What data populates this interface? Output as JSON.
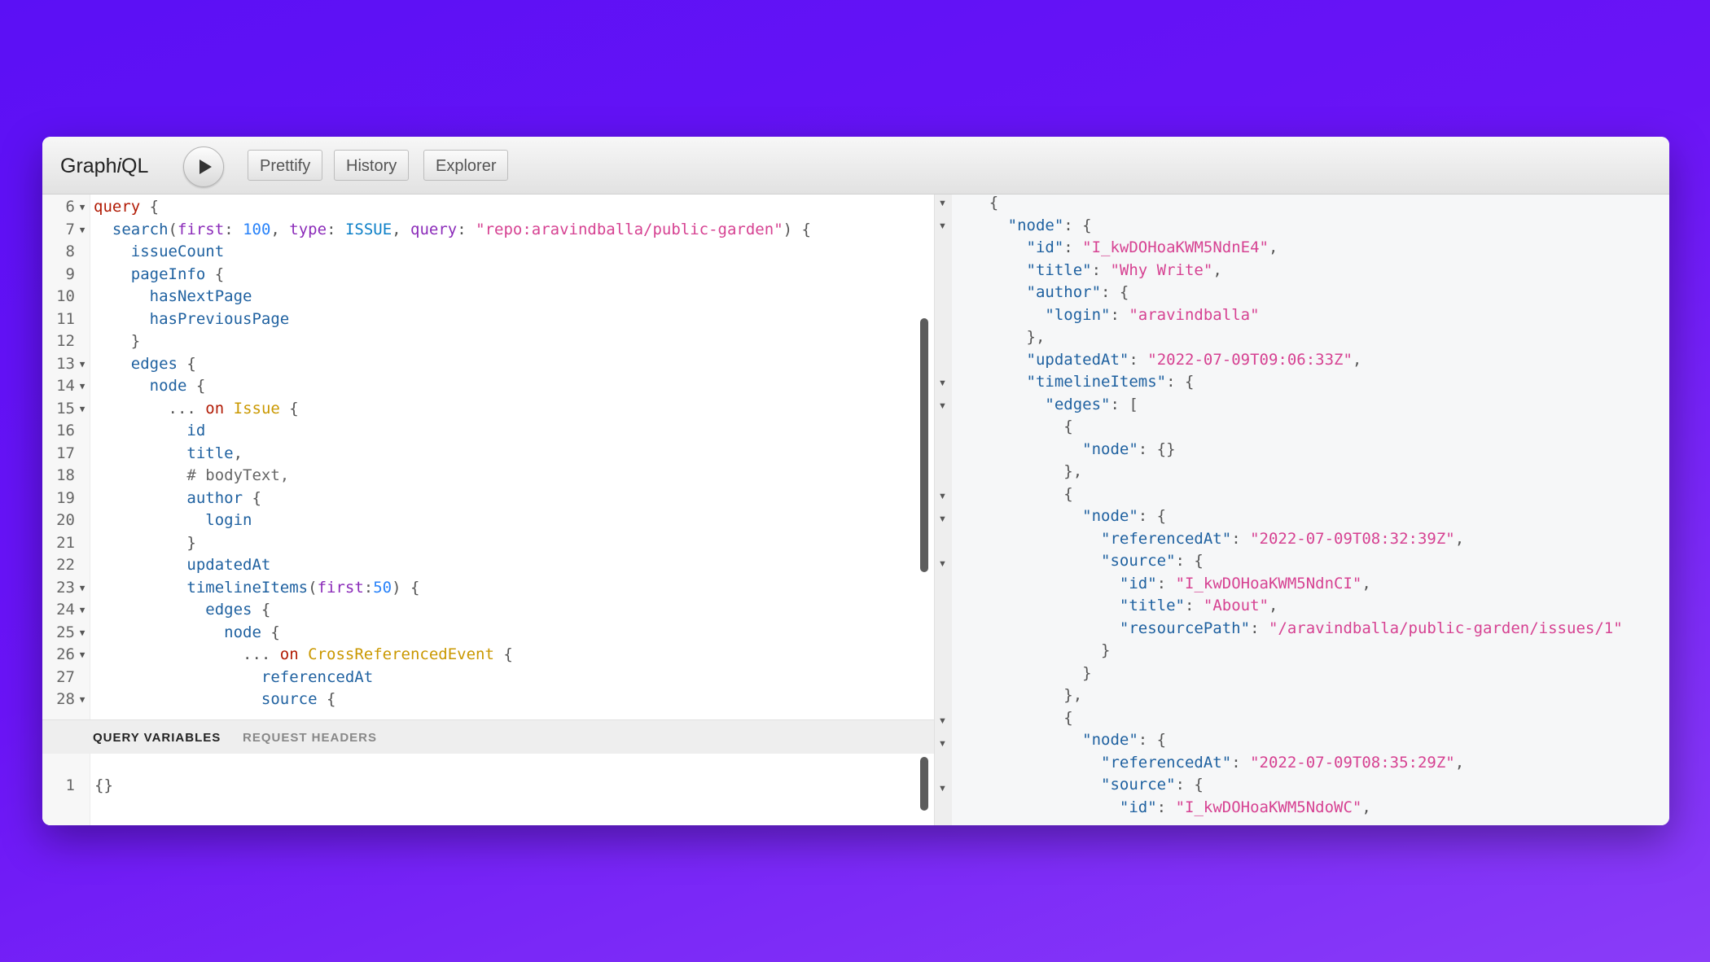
{
  "toolbar": {
    "logo_prefix": "Graph",
    "logo_i": "i",
    "logo_suffix": "QL",
    "prettify": "Prettify",
    "history": "History",
    "explorer": "Explorer"
  },
  "editor": {
    "lines": [
      {
        "n": "6",
        "fold": true,
        "tokens": [
          [
            "kw",
            "query"
          ],
          [
            "pn",
            " {"
          ]
        ]
      },
      {
        "n": "7",
        "fold": true,
        "tokens": [
          [
            "pn",
            "  "
          ],
          [
            "fn",
            "search"
          ],
          [
            "pn",
            "("
          ],
          [
            "at",
            "first"
          ],
          [
            "pn",
            ": "
          ],
          [
            "num",
            "100"
          ],
          [
            "pn",
            ", "
          ],
          [
            "at",
            "type"
          ],
          [
            "pn",
            ": "
          ],
          [
            "en",
            "ISSUE"
          ],
          [
            "pn",
            ", "
          ],
          [
            "at",
            "query"
          ],
          [
            "pn",
            ": "
          ],
          [
            "s",
            "\"repo:aravindballa/public-garden\""
          ],
          [
            "pn",
            ") {"
          ]
        ]
      },
      {
        "n": "8",
        "fold": false,
        "tokens": [
          [
            "pn",
            "    "
          ],
          [
            "k",
            "issueCount"
          ]
        ]
      },
      {
        "n": "9",
        "fold": false,
        "tokens": [
          [
            "pn",
            "    "
          ],
          [
            "k",
            "pageInfo"
          ],
          [
            "pn",
            " {"
          ]
        ]
      },
      {
        "n": "10",
        "fold": false,
        "tokens": [
          [
            "pn",
            "      "
          ],
          [
            "k",
            "hasNextPage"
          ]
        ]
      },
      {
        "n": "11",
        "fold": false,
        "tokens": [
          [
            "pn",
            "      "
          ],
          [
            "k",
            "hasPreviousPage"
          ]
        ]
      },
      {
        "n": "12",
        "fold": false,
        "tokens": [
          [
            "pn",
            "    }"
          ]
        ]
      },
      {
        "n": "13",
        "fold": true,
        "tokens": [
          [
            "pn",
            "    "
          ],
          [
            "k",
            "edges"
          ],
          [
            "pn",
            " {"
          ]
        ]
      },
      {
        "n": "14",
        "fold": true,
        "tokens": [
          [
            "pn",
            "      "
          ],
          [
            "k",
            "node"
          ],
          [
            "pn",
            " {"
          ]
        ]
      },
      {
        "n": "15",
        "fold": true,
        "tokens": [
          [
            "pn",
            "        ... "
          ],
          [
            "kw",
            "on"
          ],
          [
            "pn",
            " "
          ],
          [
            "ty",
            "Issue"
          ],
          [
            "pn",
            " {"
          ]
        ]
      },
      {
        "n": "16",
        "fold": false,
        "tokens": [
          [
            "pn",
            "          "
          ],
          [
            "k",
            "id"
          ]
        ]
      },
      {
        "n": "17",
        "fold": false,
        "tokens": [
          [
            "pn",
            "          "
          ],
          [
            "k",
            "title"
          ],
          [
            "pn",
            ","
          ]
        ]
      },
      {
        "n": "18",
        "fold": false,
        "tokens": [
          [
            "pn",
            "          "
          ],
          [
            "cm",
            "# bodyText,"
          ]
        ]
      },
      {
        "n": "19",
        "fold": false,
        "tokens": [
          [
            "pn",
            "          "
          ],
          [
            "k",
            "author"
          ],
          [
            "pn",
            " {"
          ]
        ]
      },
      {
        "n": "20",
        "fold": false,
        "tokens": [
          [
            "pn",
            "            "
          ],
          [
            "k",
            "login"
          ]
        ]
      },
      {
        "n": "21",
        "fold": false,
        "tokens": [
          [
            "pn",
            "          }"
          ]
        ]
      },
      {
        "n": "22",
        "fold": false,
        "tokens": [
          [
            "pn",
            "          "
          ],
          [
            "k",
            "updatedAt"
          ]
        ]
      },
      {
        "n": "23",
        "fold": true,
        "tokens": [
          [
            "pn",
            "          "
          ],
          [
            "k",
            "timelineItems"
          ],
          [
            "pn",
            "("
          ],
          [
            "at",
            "first"
          ],
          [
            "pn",
            ":"
          ],
          [
            "num",
            "50"
          ],
          [
            "pn",
            ") {"
          ]
        ]
      },
      {
        "n": "24",
        "fold": true,
        "tokens": [
          [
            "pn",
            "            "
          ],
          [
            "k",
            "edges"
          ],
          [
            "pn",
            " {"
          ]
        ]
      },
      {
        "n": "25",
        "fold": true,
        "tokens": [
          [
            "pn",
            "              "
          ],
          [
            "k",
            "node"
          ],
          [
            "pn",
            " {"
          ]
        ]
      },
      {
        "n": "26",
        "fold": true,
        "tokens": [
          [
            "pn",
            "                ... "
          ],
          [
            "kw",
            "on"
          ],
          [
            "pn",
            " "
          ],
          [
            "ty",
            "CrossReferencedEvent"
          ],
          [
            "pn",
            " {"
          ]
        ]
      },
      {
        "n": "27",
        "fold": false,
        "tokens": [
          [
            "pn",
            "                  "
          ],
          [
            "k",
            "referencedAt"
          ]
        ]
      },
      {
        "n": "28",
        "fold": true,
        "tokens": [
          [
            "pn",
            "                  "
          ],
          [
            "k",
            "source"
          ],
          [
            "pn",
            " {"
          ]
        ]
      }
    ]
  },
  "variables": {
    "tab_query_variables": "QUERY VARIABLES",
    "tab_request_headers": "REQUEST HEADERS",
    "line_number": "1",
    "content": "{}"
  },
  "result": {
    "lines": [
      {
        "fold": false,
        "tokens": [
          [
            "pn",
            "    {"
          ]
        ]
      },
      {
        "fold": true,
        "tokens": [
          [
            "pn",
            "      "
          ],
          [
            "k",
            "\"node\""
          ],
          [
            "pn",
            ": {"
          ]
        ]
      },
      {
        "fold": false,
        "tokens": [
          [
            "pn",
            "        "
          ],
          [
            "k",
            "\"id\""
          ],
          [
            "pn",
            ": "
          ],
          [
            "s",
            "\"I_kwDOHoaKWM5NdnE4\""
          ],
          [
            "pn",
            ","
          ]
        ]
      },
      {
        "fold": false,
        "tokens": [
          [
            "pn",
            "        "
          ],
          [
            "k",
            "\"title\""
          ],
          [
            "pn",
            ": "
          ],
          [
            "s",
            "\"Why Write\""
          ],
          [
            "pn",
            ","
          ]
        ]
      },
      {
        "fold": false,
        "tokens": [
          [
            "pn",
            "        "
          ],
          [
            "k",
            "\"author\""
          ],
          [
            "pn",
            ": {"
          ]
        ]
      },
      {
        "fold": false,
        "tokens": [
          [
            "pn",
            "          "
          ],
          [
            "k",
            "\"login\""
          ],
          [
            "pn",
            ": "
          ],
          [
            "s",
            "\"aravindballa\""
          ]
        ]
      },
      {
        "fold": false,
        "tokens": [
          [
            "pn",
            "        },"
          ]
        ]
      },
      {
        "fold": false,
        "tokens": [
          [
            "pn",
            "        "
          ],
          [
            "k",
            "\"updatedAt\""
          ],
          [
            "pn",
            ": "
          ],
          [
            "s",
            "\"2022-07-09T09:06:33Z\""
          ],
          [
            "pn",
            ","
          ]
        ]
      },
      {
        "fold": true,
        "tokens": [
          [
            "pn",
            "        "
          ],
          [
            "k",
            "\"timelineItems\""
          ],
          [
            "pn",
            ": {"
          ]
        ]
      },
      {
        "fold": true,
        "tokens": [
          [
            "pn",
            "          "
          ],
          [
            "k",
            "\"edges\""
          ],
          [
            "pn",
            ": ["
          ]
        ]
      },
      {
        "fold": false,
        "tokens": [
          [
            "pn",
            "            {"
          ]
        ]
      },
      {
        "fold": false,
        "tokens": [
          [
            "pn",
            "              "
          ],
          [
            "k",
            "\"node\""
          ],
          [
            "pn",
            ": {}"
          ]
        ]
      },
      {
        "fold": false,
        "tokens": [
          [
            "pn",
            "            },"
          ]
        ]
      },
      {
        "fold": true,
        "tokens": [
          [
            "pn",
            "            {"
          ]
        ]
      },
      {
        "fold": true,
        "tokens": [
          [
            "pn",
            "              "
          ],
          [
            "k",
            "\"node\""
          ],
          [
            "pn",
            ": {"
          ]
        ]
      },
      {
        "fold": false,
        "tokens": [
          [
            "pn",
            "                "
          ],
          [
            "k",
            "\"referencedAt\""
          ],
          [
            "pn",
            ": "
          ],
          [
            "s",
            "\"2022-07-09T08:32:39Z\""
          ],
          [
            "pn",
            ","
          ]
        ]
      },
      {
        "fold": true,
        "tokens": [
          [
            "pn",
            "                "
          ],
          [
            "k",
            "\"source\""
          ],
          [
            "pn",
            ": {"
          ]
        ]
      },
      {
        "fold": false,
        "tokens": [
          [
            "pn",
            "                  "
          ],
          [
            "k",
            "\"id\""
          ],
          [
            "pn",
            ": "
          ],
          [
            "s",
            "\"I_kwDOHoaKWM5NdnCI\""
          ],
          [
            "pn",
            ","
          ]
        ]
      },
      {
        "fold": false,
        "tokens": [
          [
            "pn",
            "                  "
          ],
          [
            "k",
            "\"title\""
          ],
          [
            "pn",
            ": "
          ],
          [
            "s",
            "\"About\""
          ],
          [
            "pn",
            ","
          ]
        ]
      },
      {
        "fold": false,
        "tokens": [
          [
            "pn",
            "                  "
          ],
          [
            "k",
            "\"resourcePath\""
          ],
          [
            "pn",
            ": "
          ],
          [
            "s",
            "\"/aravindballa/public-garden/issues/1\""
          ]
        ]
      },
      {
        "fold": false,
        "tokens": [
          [
            "pn",
            "                }"
          ]
        ]
      },
      {
        "fold": false,
        "tokens": [
          [
            "pn",
            "              }"
          ]
        ]
      },
      {
        "fold": false,
        "tokens": [
          [
            "pn",
            "            },"
          ]
        ]
      },
      {
        "fold": true,
        "tokens": [
          [
            "pn",
            "            {"
          ]
        ]
      },
      {
        "fold": true,
        "tokens": [
          [
            "pn",
            "              "
          ],
          [
            "k",
            "\"node\""
          ],
          [
            "pn",
            ": {"
          ]
        ]
      },
      {
        "fold": false,
        "tokens": [
          [
            "pn",
            "                "
          ],
          [
            "k",
            "\"referencedAt\""
          ],
          [
            "pn",
            ": "
          ],
          [
            "s",
            "\"2022-07-09T08:35:29Z\""
          ],
          [
            "pn",
            ","
          ]
        ]
      },
      {
        "fold": true,
        "tokens": [
          [
            "pn",
            "                "
          ],
          [
            "k",
            "\"source\""
          ],
          [
            "pn",
            ": {"
          ]
        ]
      },
      {
        "fold": false,
        "tokens": [
          [
            "pn",
            "                  "
          ],
          [
            "k",
            "\"id\""
          ],
          [
            "pn",
            ": "
          ],
          [
            "s",
            "\"I_kwDOHoaKWM5NdoWC\""
          ],
          [
            "pn",
            ","
          ]
        ]
      }
    ]
  }
}
